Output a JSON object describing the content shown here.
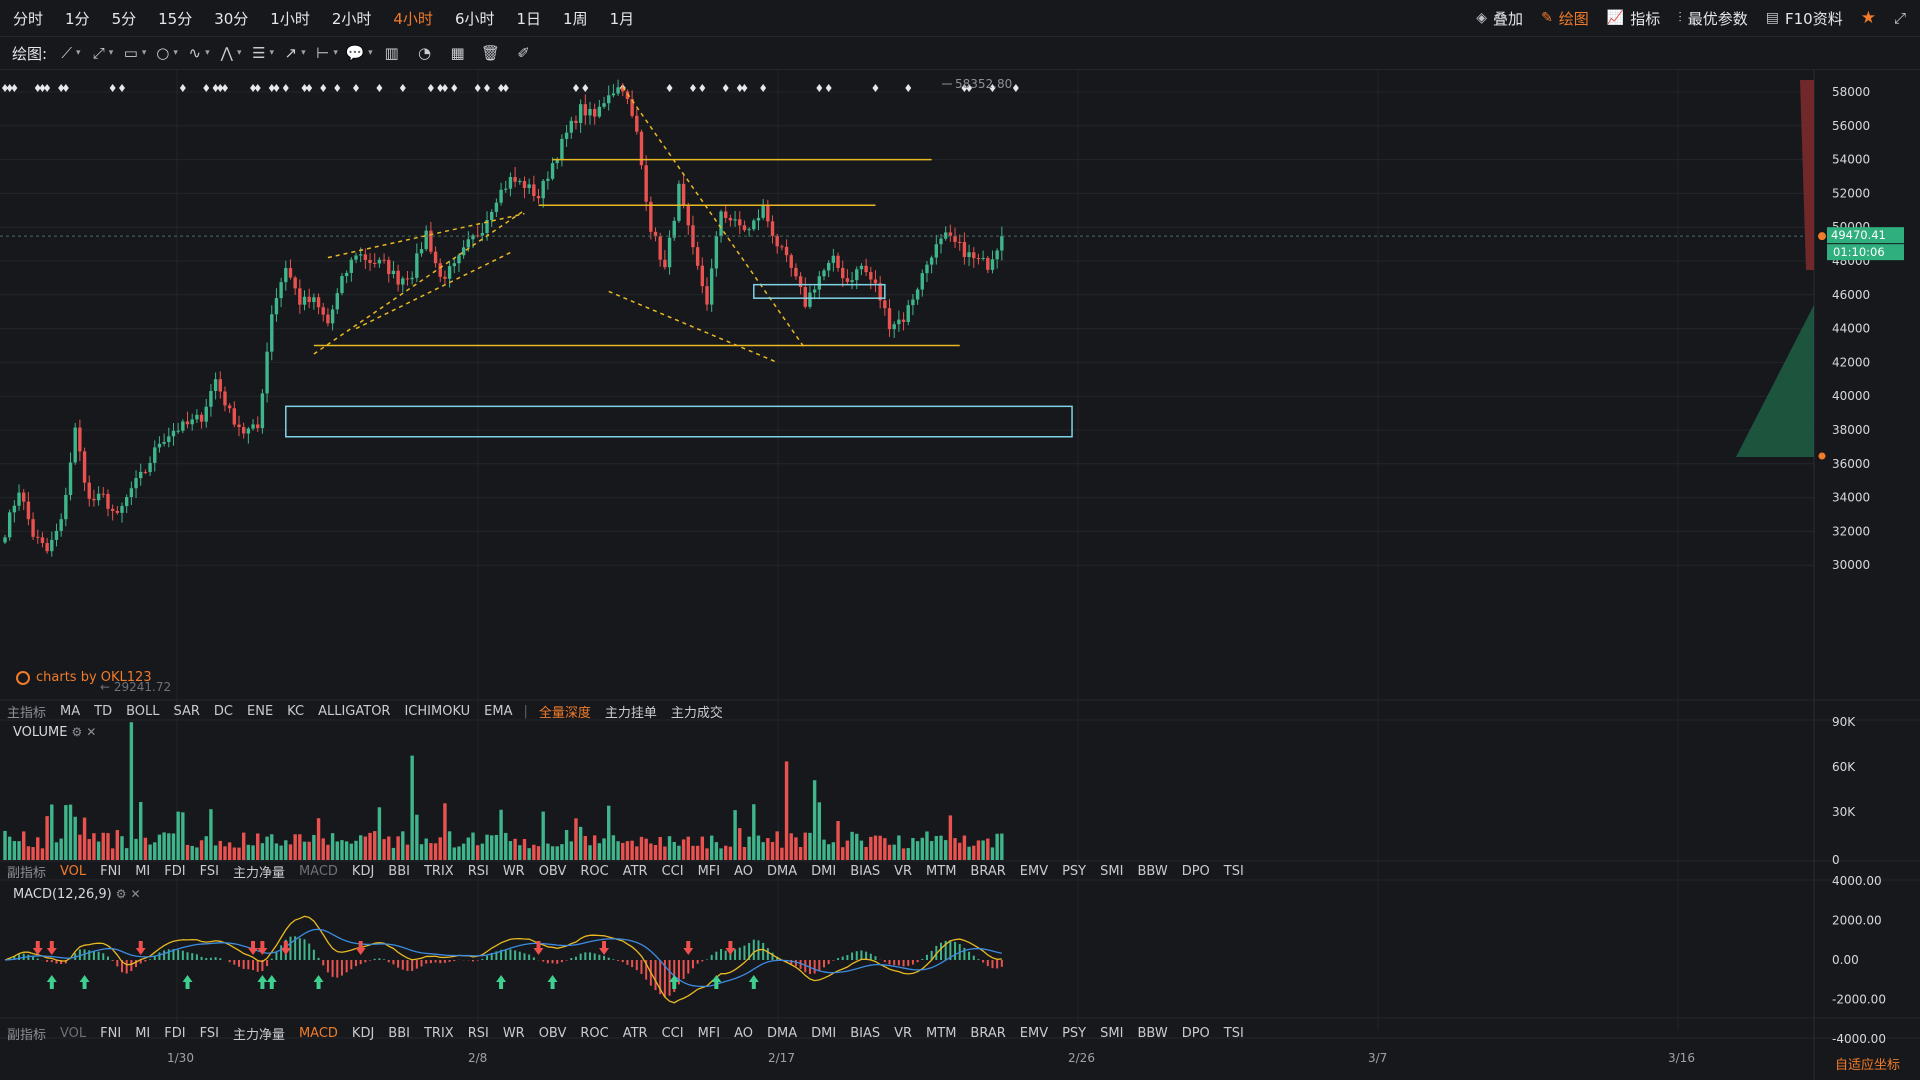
{
  "toolbar": {
    "periods": [
      {
        "label": "分时",
        "active": false
      },
      {
        "label": "1分",
        "active": false
      },
      {
        "label": "5分",
        "active": false
      },
      {
        "label": "15分",
        "active": false
      },
      {
        "label": "30分",
        "active": false
      },
      {
        "label": "1小时",
        "active": false
      },
      {
        "label": "2小时",
        "active": false
      },
      {
        "label": "4小时",
        "active": true
      },
      {
        "label": "6小时",
        "active": false
      },
      {
        "label": "1日",
        "active": false
      },
      {
        "label": "1周",
        "active": false
      },
      {
        "label": "1月",
        "active": false
      }
    ],
    "overlay_label": "叠加",
    "draw_label": "绘图",
    "indicator_label": "指标",
    "params_label": "最优参数",
    "f10_label": "F10资料"
  },
  "drawing_toolbar": {
    "label": "绘图:"
  },
  "main_indicators": {
    "label": "主指标",
    "items": [
      "MA",
      "TD",
      "BOLL",
      "SAR",
      "DC",
      "ENE",
      "KC",
      "ALLIGATOR",
      "ICHIMOKU",
      "EMA"
    ],
    "depth": [
      "全量深度",
      "主力挂单",
      "主力成交"
    ]
  },
  "sub_indicators": {
    "label": "副指标",
    "items": [
      "VOL",
      "FNI",
      "MI",
      "FDI",
      "FSI",
      "主力净量",
      "MACD",
      "KDJ",
      "BBI",
      "TRIX",
      "RSI",
      "WR",
      "OBV",
      "ROC",
      "ATR",
      "CCI",
      "MFI",
      "AO",
      "DMA",
      "DMI",
      "BIAS",
      "VR",
      "MTM",
      "BRAR",
      "EMV",
      "PSY",
      "SMI",
      "BBW",
      "DPO",
      "TSI"
    ]
  },
  "volume_pane": {
    "title": "VOLUME",
    "active": "VOL"
  },
  "macd_pane": {
    "title": "MACD(12,26,9)",
    "active": "MACD"
  },
  "branding": {
    "text": "charts by OKL123"
  },
  "footer": {
    "adaptive_label": "自适应坐标"
  },
  "colors": {
    "up": "#3fb58c",
    "down": "#e9524f",
    "accent": "#f07b2a",
    "bg": "#17181c",
    "cyan": "#7fd3e6",
    "gold": "#e8b923"
  },
  "chart_data": {
    "type": "candlestick",
    "timeframe": "4小时",
    "price_axis": {
      "ticks": [
        30000,
        32000,
        34000,
        36000,
        38000,
        40000,
        42000,
        44000,
        46000,
        48000,
        50000,
        52000,
        54000,
        56000,
        58000
      ]
    },
    "volume_axis": {
      "ticks": [
        "0",
        "30K",
        "60K",
        "90K"
      ]
    },
    "macd_axis": {
      "ticks": [
        "-4000.00",
        "-2000.00",
        "0.00",
        "2000.00",
        "4000.00"
      ]
    },
    "date_ticks": [
      "1/30",
      "2/8",
      "2/17",
      "2/26",
      "3/7",
      "3/16"
    ],
    "high_label": "58352.80",
    "low_label": "29241.72",
    "last_price": "49470.41",
    "countdown": "01:10:06",
    "path": [
      [
        0,
        32000
      ],
      [
        3,
        34500
      ],
      [
        6,
        31800
      ],
      [
        9,
        30800
      ],
      [
        12,
        32500
      ],
      [
        15,
        38000
      ],
      [
        18,
        33800
      ],
      [
        21,
        34000
      ],
      [
        24,
        32800
      ],
      [
        27,
        34500
      ],
      [
        30,
        35600
      ],
      [
        33,
        37300
      ],
      [
        36,
        38000
      ],
      [
        39,
        38300
      ],
      [
        42,
        38800
      ],
      [
        45,
        41000
      ],
      [
        48,
        39000
      ],
      [
        51,
        37900
      ],
      [
        54,
        38100
      ],
      [
        57,
        45000
      ],
      [
        60,
        47700
      ],
      [
        63,
        45600
      ],
      [
        66,
        45600
      ],
      [
        69,
        44300
      ],
      [
        72,
        46800
      ],
      [
        75,
        48500
      ],
      [
        78,
        48000
      ],
      [
        81,
        47800
      ],
      [
        84,
        46900
      ],
      [
        87,
        47300
      ],
      [
        90,
        49700
      ],
      [
        93,
        47000
      ],
      [
        96,
        47600
      ],
      [
        99,
        49000
      ],
      [
        102,
        50000
      ],
      [
        105,
        51800
      ],
      [
        108,
        52800
      ],
      [
        111,
        52500
      ],
      [
        114,
        51800
      ],
      [
        117,
        53800
      ],
      [
        120,
        55500
      ],
      [
        123,
        57000
      ],
      [
        126,
        56500
      ],
      [
        129,
        58000
      ],
      [
        132,
        58350
      ],
      [
        135,
        55500
      ],
      [
        138,
        50000
      ],
      [
        141,
        47500
      ],
      [
        144,
        52300
      ],
      [
        147,
        48500
      ],
      [
        150,
        45600
      ],
      [
        153,
        51000
      ],
      [
        156,
        50200
      ],
      [
        159,
        49800
      ],
      [
        162,
        51100
      ],
      [
        165,
        49000
      ],
      [
        168,
        47500
      ],
      [
        171,
        45500
      ],
      [
        174,
        47100
      ],
      [
        177,
        48000
      ],
      [
        180,
        46800
      ],
      [
        183,
        47700
      ],
      [
        186,
        46500
      ],
      [
        189,
        44300
      ],
      [
        192,
        44600
      ],
      [
        195,
        46500
      ],
      [
        198,
        48500
      ],
      [
        201,
        49400
      ],
      [
        204,
        48800
      ],
      [
        207,
        48100
      ],
      [
        210,
        47800
      ],
      [
        213,
        49470
      ]
    ],
    "horizontal_lines": [
      {
        "price": 54000,
        "from": 117,
        "to": 198,
        "color": "gold"
      },
      {
        "price": 51300,
        "from": 114,
        "to": 186,
        "color": "gold"
      },
      {
        "price": 43000,
        "from": 66,
        "to": 204,
        "color": "gold"
      }
    ],
    "trend_lines": [
      {
        "p1": [
          66,
          42500
        ],
        "p2": [
          111,
          51000
        ]
      },
      {
        "p1": [
          69,
          48200
        ],
        "p2": [
          111,
          50800
        ]
      },
      {
        "p1": [
          75,
          44000
        ],
        "p2": [
          108,
          48500
        ]
      },
      {
        "p1": [
          132,
          58300
        ],
        "p2": [
          171,
          42800
        ]
      },
      {
        "p1": [
          129,
          46200
        ],
        "p2": [
          165,
          42000
        ]
      }
    ],
    "zones": [
      {
        "price_low": 37600,
        "price_high": 39400,
        "from": 60,
        "to": 228
      },
      {
        "price_low": 45800,
        "price_high": 46600,
        "from": 160,
        "to": 188
      }
    ],
    "macd_signals": {
      "buy": [
        10,
        17,
        39,
        55,
        57,
        67,
        106,
        117,
        143,
        152,
        160
      ],
      "sell": [
        7,
        10,
        29,
        53,
        55,
        60,
        76,
        114,
        128,
        146,
        155
      ]
    }
  }
}
